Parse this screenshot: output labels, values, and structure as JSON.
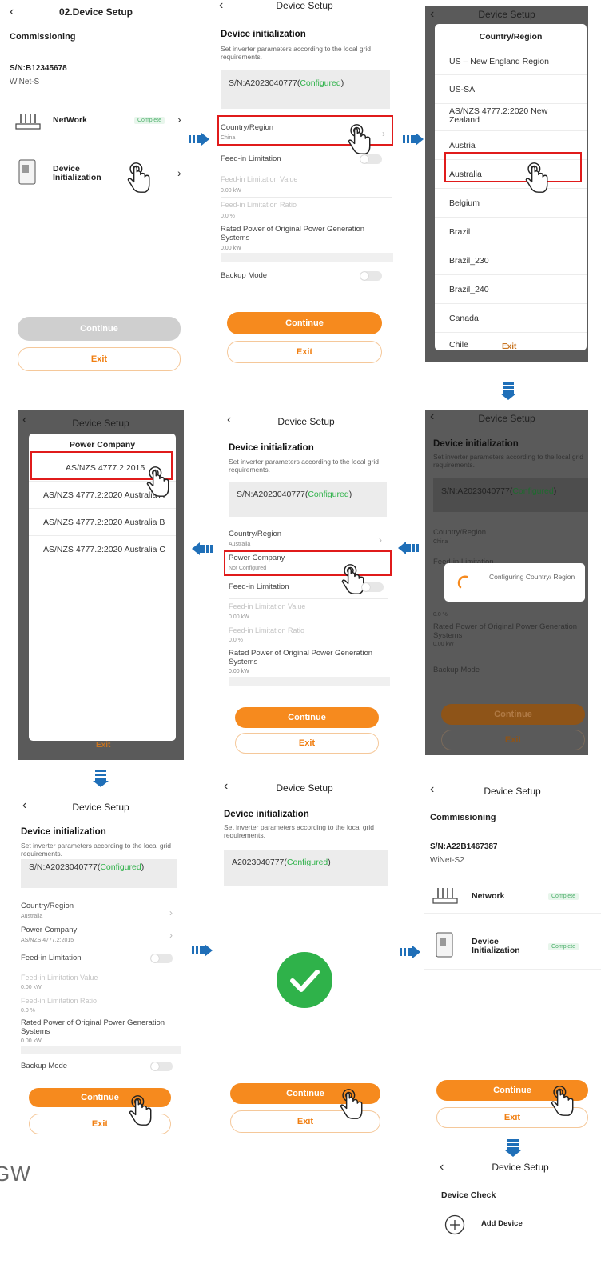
{
  "colors": {
    "accent": "#f68a1e",
    "configured": "#2fb24a",
    "highlight": "#e01b1b",
    "arrow": "#1f6fb8"
  },
  "common": {
    "back_icon": "chevron-left-icon",
    "device_setup": "Device Setup",
    "device_init_title": "Device initialization",
    "device_init_desc": "Set inverter parameters according to the local grid requirements.",
    "sn_prefix": "S/N:A2023040777(",
    "configured": "Configured",
    "sn_suffix": ")",
    "continue": "Continue",
    "exit": "Exit",
    "country_region": "Country/Region",
    "power_company": "Power Company",
    "feed_in_limitation": "Feed-in Limitation",
    "feed_in_value": "Feed-in Limitation Value",
    "feed_in_value_default": "0.00 kW",
    "feed_in_ratio": "Feed-in Limitation Ratio",
    "feed_in_ratio_default": "0.0 %",
    "rated_power": "Rated Power of Original Power Generation Systems",
    "rated_power_default": "0.00 kW",
    "backup_mode": "Backup Mode",
    "complete": "Complete"
  },
  "step1": {
    "title": "02.Device Setup",
    "section": "Commissioning",
    "sn": "S/N:B12345678",
    "model": "WiNet-S",
    "network_label": "NetWork",
    "network_status": "Complete",
    "device_init_label": "Device\nInitialization"
  },
  "step2": {
    "country_value": "China"
  },
  "step3": {
    "modal_title": "Country/Region",
    "options": [
      "US – New England Region",
      "US-SA",
      "AS/NZS 4777.2:2020 New Zealand",
      "Austria",
      "Australia",
      "Belgium",
      "Brazil",
      "Brazil_230",
      "Brazil_240",
      "Canada",
      "Chile"
    ],
    "selected": "Australia"
  },
  "step4": {
    "loading_text": "Configuring Country/ Region"
  },
  "step5": {
    "country_value": "Australia",
    "power_company_value": "Not Configured"
  },
  "step6": {
    "modal_title": "Power Company",
    "options": [
      "AS/NZS 4777.2:2015",
      "AS/NZS 4777.2:2020 Australia A",
      "AS/NZS 4777.2:2020 Australia B",
      "AS/NZS 4777.2:2020 Australia C"
    ],
    "selected": "AS/NZS 4777.2:2015"
  },
  "step7": {
    "country_value": "Australia",
    "power_company_value": "AS/NZS 4777.2:2015"
  },
  "step8": {
    "sn": "A2023040777("
  },
  "step9": {
    "section": "Commissioning",
    "sn": "S/N:A22B1467387",
    "model": "WiNet-S2",
    "network_label": "Network",
    "device_init_label": "Device\nInitialization"
  },
  "step10": {
    "section": "Device Check",
    "add_device": "Add Device"
  },
  "footer_logo_text": "GW"
}
